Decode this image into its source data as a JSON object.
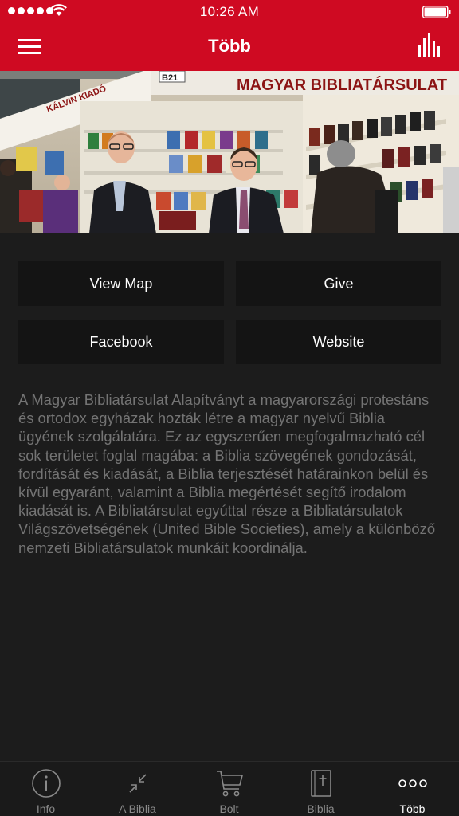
{
  "status_bar": {
    "time": "10:26 AM"
  },
  "nav": {
    "title": "Több"
  },
  "hero": {
    "booth_code": "B21",
    "banner_text": "MAGYAR BIBLIATÁRSULAT",
    "side_banner": "KÁLVIN KIADÓ"
  },
  "buttons": {
    "view_map": "View Map",
    "give": "Give",
    "facebook": "Facebook",
    "website": "Website"
  },
  "description": "A Magyar Bibliatársulat Alapítványt a magyarországi protestáns és ortodox egyházak hozták létre a magyar nyelvű Biblia ügyének szolgálatára. Ez az egyszerűen megfogalmazható cél sok területet foglal magába: a Biblia szövegének gondozását, fordítását és kiadását, a Biblia terjesztését határainkon belül és kívül egyaránt, valamint a Biblia megértését segítő irodalom kiadását is. A Bibliatársulat egyúttal része a Bibliatársulatok Világszövetségének (United Bible Societies), amely a különböző nemzeti Bibliatársulatok munkáit koordinálja.",
  "tabs": [
    {
      "label": "Info",
      "icon": "info-icon"
    },
    {
      "label": "A Biblia",
      "icon": "collapse-arrows-icon"
    },
    {
      "label": "Bolt",
      "icon": "cart-icon"
    },
    {
      "label": "Biblia",
      "icon": "bible-book-icon"
    },
    {
      "label": "Több",
      "icon": "more-dots-icon"
    }
  ],
  "colors": {
    "accent": "#cf0a22",
    "background": "#1c1c1c",
    "button": "#141414"
  }
}
